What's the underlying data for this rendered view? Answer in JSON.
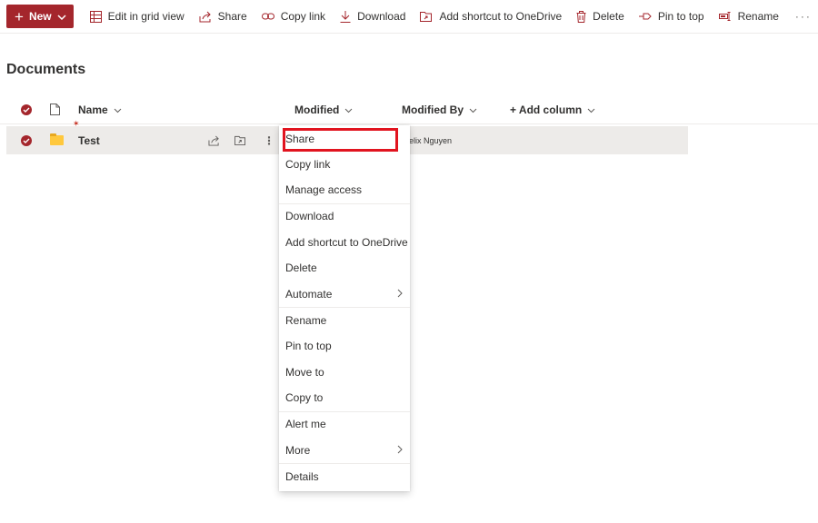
{
  "toolbar": {
    "new_label": "New",
    "items": [
      {
        "label": "Edit in grid view",
        "icon": "grid-icon"
      },
      {
        "label": "Share",
        "icon": "share-icon"
      },
      {
        "label": "Copy link",
        "icon": "link-icon"
      },
      {
        "label": "Download",
        "icon": "download-icon"
      },
      {
        "label": "Add shortcut to OneDrive",
        "icon": "shortcut-icon"
      },
      {
        "label": "Delete",
        "icon": "trash-icon"
      },
      {
        "label": "Pin to top",
        "icon": "pin-icon"
      },
      {
        "label": "Rename",
        "icon": "rename-icon"
      }
    ],
    "more_label": "···"
  },
  "page": {
    "title": "Documents"
  },
  "list": {
    "columns": {
      "name": "Name",
      "modified": "Modified",
      "modified_by": "Modified By",
      "add_column": "+ Add column"
    },
    "rows": [
      {
        "name": "Test",
        "modified_by": "elix Nguyen"
      }
    ]
  },
  "context_menu": {
    "items": [
      "Share",
      "Copy link",
      "Manage access",
      "Download",
      "Add shortcut to OneDrive",
      "Delete",
      "Automate",
      "Rename",
      "Pin to top",
      "Move to",
      "Copy to",
      "Alert me",
      "More",
      "Details"
    ]
  },
  "colors": {
    "accent": "#a4262c",
    "highlight": "#e1141f",
    "row_selected": "#edebe9",
    "folder": "#ffc83d"
  }
}
